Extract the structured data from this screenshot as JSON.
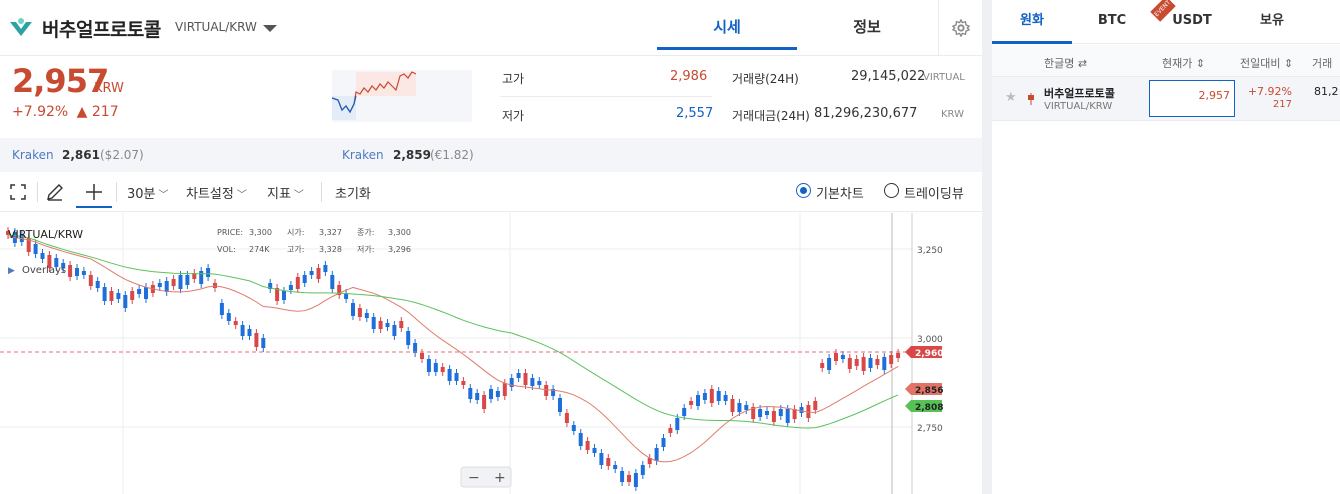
{
  "header": {
    "coin_name": "버추얼프로토콜",
    "coin_symbol": "VIRTUAL/KRW",
    "tabs": [
      "시세",
      "정보"
    ]
  },
  "quote": {
    "price": "2,957",
    "unit": "KRW",
    "change_pct": "+7.92%",
    "change_amt": "▲ 217"
  },
  "stats": {
    "high_label": "고가",
    "high": "2,986",
    "low_label": "저가",
    "low": "2,557",
    "vol_label": "거래량(24H)",
    "vol": "29,145,022",
    "vol_unit": "VIRTUAL",
    "amt_label": "거래대금(24H)",
    "amt": "81,296,230,677",
    "amt_unit": "KRW"
  },
  "exchanges": [
    {
      "name": "Kraken",
      "price": "2,861",
      "sub": "($2.07)"
    },
    {
      "name": "Kraken",
      "price": "2,859",
      "sub": "(€1.82)"
    }
  ],
  "toolbar": {
    "interval": "30분",
    "chart_settings": "차트설정",
    "indicators": "지표",
    "reset": "초기화",
    "basic_chart": "기본차트",
    "tradingview": "트레이딩뷰"
  },
  "chart_info": {
    "symbol": "VIRTUAL/KRW",
    "overlays": "Overlays",
    "price_lbl": "PRICE:",
    "price_val": "3,300",
    "open_lbl": "시가:",
    "open_val": "3,327",
    "close_lbl": "종가:",
    "close_val": "3,300",
    "vol_lbl": "VOL:",
    "vol_val": "274K",
    "high_lbl": "고가:",
    "high_val": "3,328",
    "low_lbl": "저가:",
    "low_val": "3,296"
  },
  "chart_data": {
    "type": "candlestick",
    "y_ticks": [
      "3,250",
      "3,000",
      "2,750"
    ],
    "last_price": "2,960",
    "ma1": "2,856",
    "ma2": "2,808"
  },
  "zoom": {
    "minus": "−",
    "plus": "+"
  },
  "market": {
    "tabs": [
      "원화",
      "BTC",
      "USDT",
      "보유"
    ],
    "event_badge": "EVENT",
    "cols": [
      "한글명 ⇄",
      "현재가 ⇕",
      "전일대비 ⇕",
      "거래"
    ],
    "row": {
      "name": "버추얼프로토콜",
      "symbol": "VIRTUAL/KRW",
      "price": "2,957",
      "chg_pct": "+7.92%",
      "chg_amt": "217",
      "vol": "81,2"
    }
  },
  "colors": {
    "up": "#c84a31",
    "down": "#1261c4",
    "accent": "#1261c4"
  }
}
